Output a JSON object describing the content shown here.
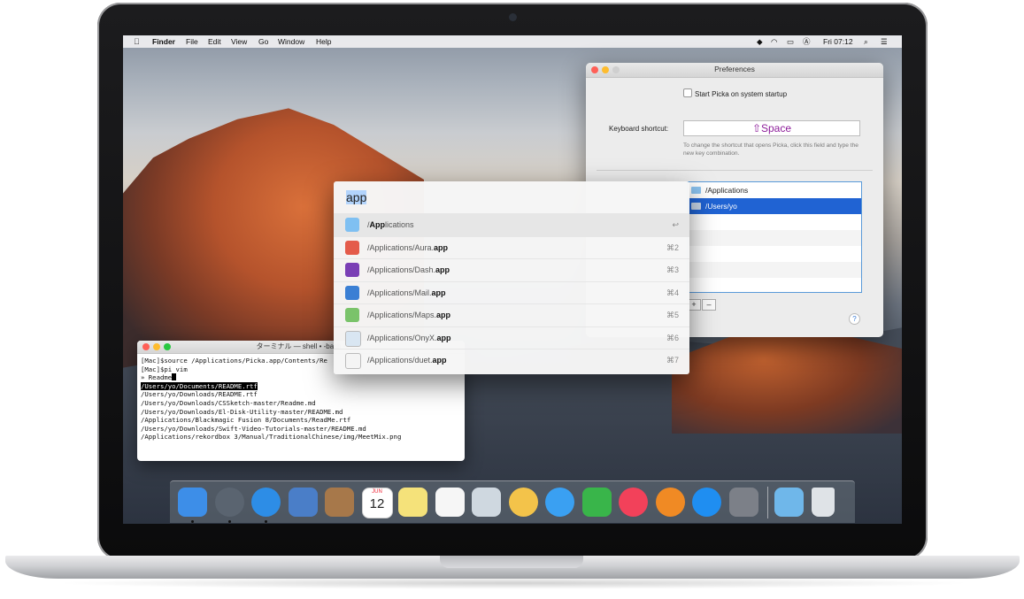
{
  "menubar": {
    "app_name": "Finder",
    "menus": [
      "File",
      "Edit",
      "View",
      "Go",
      "Window",
      "Help"
    ],
    "clock": "Fri 07:12"
  },
  "preferences": {
    "title": "Preferences",
    "startup_checkbox": "Start Picka on system startup",
    "shortcut_label": "Keyboard shortcut:",
    "shortcut_value": "⇧Space",
    "shortcut_help": "To change the shortcut that opens Picka, click this field and type the new key combination.",
    "paths": [
      "/Applications",
      "/Users/yo"
    ],
    "add_label": "+",
    "remove_label": "–",
    "help_label": "?"
  },
  "terminal": {
    "title": "ターミナル — shell • -bash -",
    "lines": [
      "[Mac]$source /Applications/Picka.app/Contents/Re",
      "[Mac]$pi vim",
      "» Readme"
    ],
    "results": [
      "/Users/yo/Documents/README.rtf",
      "/Users/yo/Downloads/README.rtf",
      "/Users/yo/Downloads/CSSketch-master/Readme.md",
      "/Users/yo/Downloads/El-Disk-Utility-master/README.md",
      "/Applications/Blackmagic Fusion 8/Documents/ReadMe.rtf",
      "/Users/yo/Downloads/Swift-Video-Tutorials-master/README.md",
      "/Applications/rekordbox 3/Manual/TraditionalChinese/img/MeetMix.png"
    ]
  },
  "picka": {
    "query": "app",
    "results": [
      {
        "prefix": "/",
        "match": "App",
        "suffix": "lications",
        "shortcut": "↩",
        "icon": "folder-icon",
        "color": "#7fc0f2"
      },
      {
        "prefix": "/Applications/Aura.",
        "match": "app",
        "suffix": "",
        "shortcut": "⌘2",
        "icon": "rocket-icon",
        "color": "#e45b4a"
      },
      {
        "prefix": "/Applications/Dash.",
        "match": "app",
        "suffix": "",
        "shortcut": "⌘3",
        "icon": "dash-icon",
        "color": "#7a3fb5"
      },
      {
        "prefix": "/Applications/Mail.",
        "match": "app",
        "suffix": "",
        "shortcut": "⌘4",
        "icon": "mail-icon",
        "color": "#3b7fd4"
      },
      {
        "prefix": "/Applications/Maps.",
        "match": "app",
        "suffix": "",
        "shortcut": "⌘5",
        "icon": "maps-icon",
        "color": "#7ac36a"
      },
      {
        "prefix": "/Applications/OnyX.",
        "match": "app",
        "suffix": "",
        "shortcut": "⌘6",
        "icon": "onyx-icon",
        "color": "#d9e6f2"
      },
      {
        "prefix": "/Applications/duet.",
        "match": "app",
        "suffix": "",
        "shortcut": "⌘7",
        "icon": "duet-icon",
        "color": "#f4f4f4"
      }
    ]
  },
  "dock": {
    "calendar_month": "JUN",
    "calendar_day": "12",
    "apps": [
      {
        "name": "finder-icon",
        "color": "#3d8ee8",
        "running": true
      },
      {
        "name": "launchpad-icon",
        "color": "#5a6470",
        "running": true
      },
      {
        "name": "safari-icon",
        "color": "#2d8de6",
        "running": true
      },
      {
        "name": "mail-app-icon",
        "color": "#4a7ec8",
        "running": false
      },
      {
        "name": "contacts-icon",
        "color": "#a7784a",
        "running": false
      },
      {
        "name": "calendar-icon",
        "color": "#ffffff",
        "running": false
      },
      {
        "name": "notes-icon",
        "color": "#f5e27a",
        "running": false
      },
      {
        "name": "reminders-icon",
        "color": "#f6f6f6",
        "running": false
      },
      {
        "name": "preview-icon",
        "color": "#cfd8e0",
        "running": false
      },
      {
        "name": "photos-icon",
        "color": "#f3c34a",
        "running": false
      },
      {
        "name": "messages-icon",
        "color": "#3aa0f2",
        "running": false
      },
      {
        "name": "facetime-icon",
        "color": "#39b54a",
        "running": false
      },
      {
        "name": "itunes-icon",
        "color": "#f2415a",
        "running": false
      },
      {
        "name": "ibooks-icon",
        "color": "#f08a24",
        "running": false
      },
      {
        "name": "app-store-icon",
        "color": "#1f8ef1",
        "running": false
      },
      {
        "name": "system-preferences-icon",
        "color": "#7c8088",
        "running": false
      },
      {
        "name": "downloads-folder-icon",
        "color": "#6fb7ea",
        "running": false
      },
      {
        "name": "trash-icon",
        "color": "#dfe3e7",
        "running": false
      }
    ]
  }
}
